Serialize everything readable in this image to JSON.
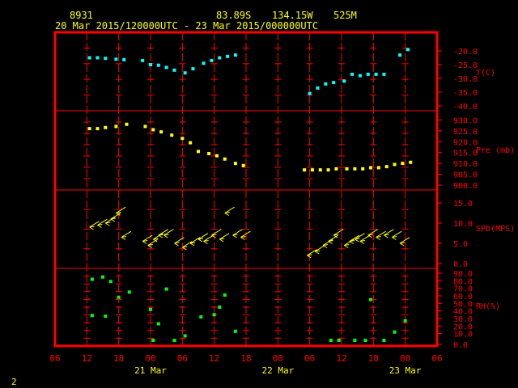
{
  "header": {
    "station_id": "8931",
    "lat": "83.89S",
    "lon": "134.15W",
    "elevation": "525M",
    "time_range": "20 Mar 2015/120000UTC - 23 Mar 2015/000000UTC"
  },
  "footer": {
    "page_number": "2"
  },
  "colors": {
    "frame": "#ff0000",
    "axis_text": "#ff0000",
    "date_text": "#ffff00",
    "temperature": "#00ffff",
    "pressure": "#ffff00",
    "wind": "#ffff00",
    "humidity": "#00ff00"
  },
  "chart_data": [
    {
      "type": "scatter",
      "ylabel": "T(C)",
      "ylim": [
        -40,
        -15
      ],
      "yticks": [
        "-20.0",
        "-25.0",
        "-30.0",
        "-35.0",
        "-40.0"
      ],
      "ytick_values": [
        -20,
        -25,
        -30,
        -35,
        -40
      ],
      "series": [
        {
          "x": [
            12.5,
            14,
            15.5,
            17.5,
            19,
            22.5,
            24,
            25.5,
            27,
            28.5,
            30.5,
            32,
            34,
            35.5,
            37,
            38.5,
            40,
            54,
            55.5,
            57,
            58.5,
            60.5,
            62,
            63.5,
            65,
            66.5,
            68,
            71,
            72.5
          ],
          "values": [
            -22.5,
            -22.5,
            -22.7,
            -23,
            -23.2,
            -23.5,
            -25,
            -25.2,
            -26,
            -27,
            -28,
            -26.5,
            -24.5,
            -23.5,
            -22.5,
            -22,
            -21.5,
            -35.5,
            -33.5,
            -32,
            -31.5,
            -31,
            -28.5,
            -29,
            -28.5,
            -28.5,
            -28.5,
            -21.5,
            -19.5
          ]
        }
      ]
    },
    {
      "type": "scatter",
      "ylabel": "Pre (mb)",
      "ylim": [
        900,
        932
      ],
      "yticks": [
        "930.0",
        "925.0",
        "920.0",
        "915.0",
        "910.0",
        "905.0",
        "900.0"
      ],
      "ytick_values": [
        930,
        925,
        920,
        915,
        910,
        905,
        900
      ],
      "series": [
        {
          "x": [
            12.5,
            14,
            15.5,
            17.5,
            19.5,
            23,
            24.5,
            26,
            28,
            30,
            31.5,
            33,
            35,
            36.5,
            38,
            40,
            41.5,
            53,
            54.5,
            56,
            57.5,
            59,
            61,
            62.5,
            64,
            65.5,
            67,
            68.5,
            70,
            71.5,
            73
          ],
          "values": [
            926,
            926,
            926.5,
            927,
            928,
            927,
            925.5,
            924.5,
            923,
            921.5,
            919.5,
            915.5,
            914.5,
            913.5,
            912,
            910,
            909,
            907,
            907,
            907,
            907,
            907.5,
            907.5,
            907.5,
            907.5,
            908,
            908,
            908.5,
            909.5,
            910,
            910.5
          ]
        }
      ]
    },
    {
      "type": "scatter",
      "ylabel": "SPD(MPS)",
      "ylim": [
        0,
        17
      ],
      "yticks": [
        "15.0",
        "10.0",
        "5.0",
        "0.0"
      ],
      "ytick_values": [
        15,
        10,
        5,
        0
      ],
      "series": [
        {
          "x": [
            12.5,
            14,
            15.5,
            16.5,
            17.5,
            18.5,
            22.5,
            23.5,
            24.5,
            25.5,
            26.5,
            28.5,
            30,
            31.5,
            33,
            34,
            35.5,
            37,
            38,
            39.5,
            41,
            53.5,
            55,
            56.5,
            57.5,
            58.5,
            60.5,
            61.5,
            62.5,
            63.5,
            65,
            66.5,
            68,
            69.5,
            71
          ],
          "values": [
            9,
            9.5,
            10,
            11,
            12.5,
            6.5,
            5.5,
            4.5,
            6,
            7,
            7,
            5,
            4,
            5,
            6,
            5.5,
            7,
            6,
            12.5,
            7,
            6.5,
            2,
            3,
            4.5,
            5.5,
            7,
            4.5,
            5.5,
            6,
            5.5,
            7,
            6.5,
            7,
            6.5,
            5
          ]
        }
      ]
    },
    {
      "type": "scatter",
      "ylabel": "RH(%)",
      "ylim": [
        0,
        90
      ],
      "yticks": [
        "90.0",
        "80.0",
        "70.0",
        "60.0",
        "50.0",
        "40.0",
        "30.0",
        "20.0",
        "10.0",
        "0.0"
      ],
      "ytick_values": [
        90,
        80,
        70,
        60,
        50,
        40,
        30,
        20,
        10,
        0
      ],
      "series": [
        {
          "x": [
            13,
            15,
            16.5,
            18,
            20,
            24,
            25.5,
            27,
            28.5,
            36,
            37,
            38,
            40,
            58,
            59.5,
            62.5,
            64.5,
            65.5,
            68,
            70,
            72
          ],
          "values": [
            82,
            85,
            79,
            58,
            65,
            42,
            23,
            69,
            1,
            35,
            45,
            61,
            13,
            1,
            1,
            1,
            1,
            55,
            1,
            12,
            27
          ]
        },
        {
          "x": [
            13,
            15.5
          ],
          "values": [
            34,
            33
          ]
        },
        {
          "x": [
            24.5,
            30.5,
            33.5
          ],
          "values": [
            1,
            7,
            32
          ]
        }
      ]
    },
    {
      "type": "axis",
      "x_ticks": [
        "06",
        "12",
        "18",
        "00",
        "06",
        "12",
        "18",
        "00",
        "06",
        "12",
        "18",
        "00",
        "06"
      ],
      "x_tick_hours": [
        6,
        12,
        18,
        24,
        30,
        36,
        42,
        48,
        54,
        60,
        66,
        72,
        78
      ],
      "date_labels": [
        "21 Mar",
        "22 Mar",
        "23 Mar"
      ],
      "date_label_hours": [
        24,
        48,
        72
      ]
    }
  ]
}
